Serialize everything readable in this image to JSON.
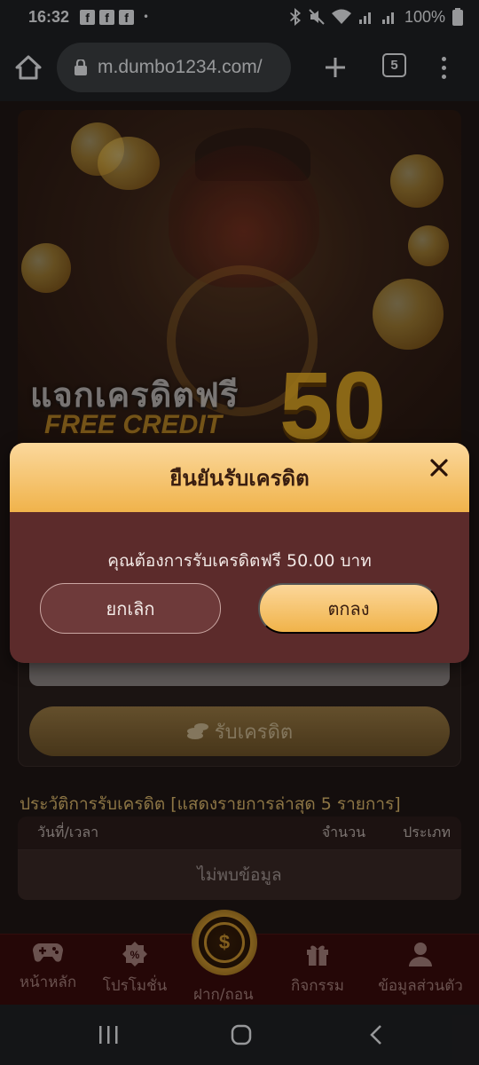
{
  "status_bar": {
    "time": "16:32",
    "notification_icons": [
      "facebook-icon",
      "facebook-icon",
      "facebook-icon"
    ],
    "dot": "•",
    "battery": "100%"
  },
  "browser": {
    "url": "m.dumbo1234.com/",
    "tab_count": "5"
  },
  "banner": {
    "title_thai": "แจกเครดิตฟรี",
    "subtitle": "FREE CREDIT",
    "amount": "50"
  },
  "credit_card": {
    "claim_label": "รับเครดิต"
  },
  "history": {
    "title": "ประวัติการรับเครดิต [แสดงรายการล่าสุด 5 รายการ]",
    "columns": [
      "วันที่/เวลา",
      "จำนวน",
      "ประเภท"
    ],
    "empty_text": "ไม่พบข้อมูล"
  },
  "bottom_nav": {
    "items": [
      {
        "label": "หน้าหลัก",
        "icon": "gamepad-icon"
      },
      {
        "label": "โปรโมชั่น",
        "icon": "promo-badge-icon"
      },
      {
        "label": "ฝาก/ถอน",
        "icon": "deposit-withdraw-icon"
      },
      {
        "label": "กิจกรรม",
        "icon": "gift-icon"
      },
      {
        "label": "ข้อมูลส่วนตัว",
        "icon": "user-icon"
      }
    ]
  },
  "modal": {
    "title": "ยืนยันรับเครดิต",
    "message": "คุณต้องการรับเครดิตฟรี 50.00 บาท",
    "cancel_label": "ยกเลิก",
    "ok_label": "ตกลง"
  },
  "colors": {
    "accent_gold": "#f0b34b",
    "modal_body": "#5c2b2b",
    "nav_bg": "#3a0c0c"
  }
}
